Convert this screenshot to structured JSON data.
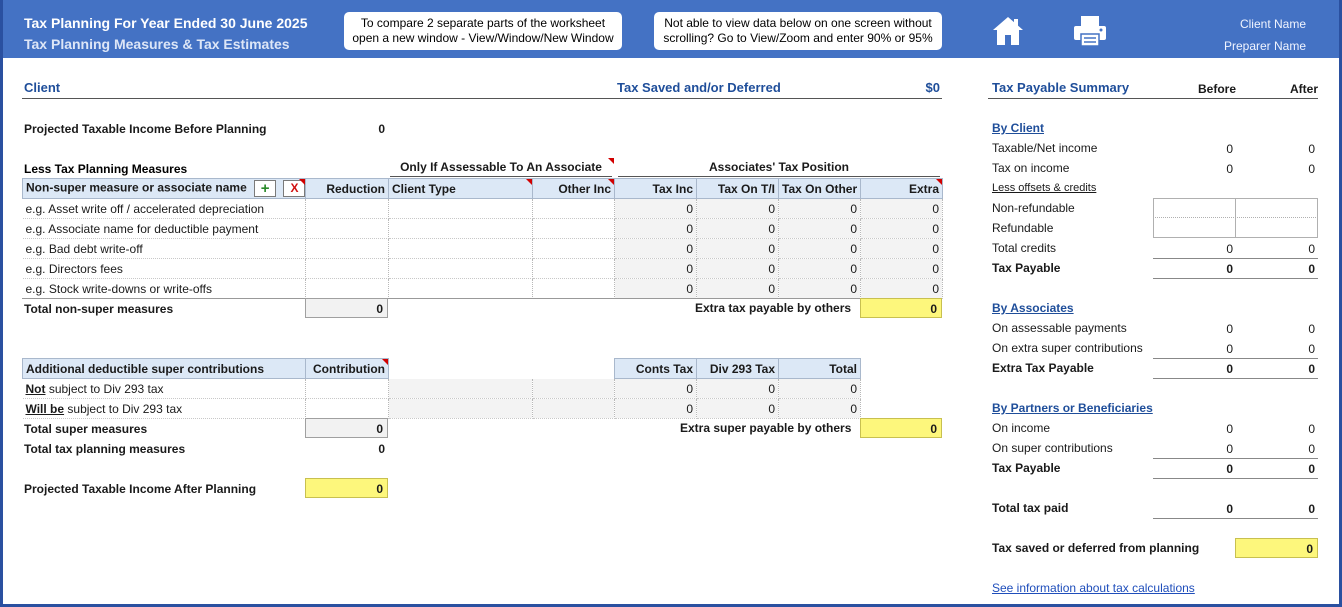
{
  "header": {
    "title": "Tax Planning For Year Ended 30 June 2025",
    "subtitle": "Tax Planning Measures & Tax Estimates",
    "note1_line1": "To compare 2 separate parts of the worksheet",
    "note1_line2": "open a new window - View/Window/New Window",
    "note2_line1": "Not able to view data below on one screen without",
    "note2_line2": "scrolling? Go to View/Zoom and enter 90% or 95%",
    "client_name": "Client Name",
    "preparer_name": "Preparer Name"
  },
  "left": {
    "client_label": "Client",
    "tax_saved_label": "Tax Saved and/or Deferred",
    "tax_saved_value": "$0",
    "projected_before_label": "Projected Taxable Income Before Planning",
    "projected_before_value": "0",
    "less_measures_label": "Less Tax Planning Measures",
    "assoc_only_label": "Only If Assessable To An Associate",
    "assoc_position_label": "Associates' Tax Position",
    "nonsuper_headers": [
      "Non-super measure or associate name",
      "Reduction",
      "Client Type",
      "Other Inc",
      "Tax Inc",
      "Tax On T/I",
      "Tax On Other",
      "Extra"
    ],
    "add_label": "+",
    "delete_label": "X",
    "nonsuper_rows": [
      {
        "name": "e.g. Asset write off / accelerated depreciation",
        "tax_inc": "0",
        "tax_ti": "0",
        "tax_other": "0",
        "extra": "0"
      },
      {
        "name": "e.g. Associate name for deductible payment",
        "tax_inc": "0",
        "tax_ti": "0",
        "tax_other": "0",
        "extra": "0"
      },
      {
        "name": "e.g. Bad debt write-off",
        "tax_inc": "0",
        "tax_ti": "0",
        "tax_other": "0",
        "extra": "0"
      },
      {
        "name": "e.g. Directors fees",
        "tax_inc": "0",
        "tax_ti": "0",
        "tax_other": "0",
        "extra": "0"
      },
      {
        "name": "e.g. Stock write-downs or write-offs",
        "tax_inc": "0",
        "tax_ti": "0",
        "tax_other": "0",
        "extra": "0"
      }
    ],
    "total_nonsuper_label": "Total non-super measures",
    "total_nonsuper_value": "0",
    "extra_tax_others_label": "Extra tax payable by others",
    "extra_tax_others_value": "0",
    "super_headers": [
      "Additional deductible super contributions",
      "Contribution",
      "Conts Tax",
      "Div 293 Tax",
      "Total"
    ],
    "super_rows": [
      {
        "prefix": "Not",
        "rest": " subject to Div 293 tax",
        "cont_tax": "0",
        "div293": "0",
        "total": "0"
      },
      {
        "prefix": "Will be",
        "rest": " subject to Div 293 tax",
        "cont_tax": "0",
        "div293": "0",
        "total": "0"
      }
    ],
    "total_super_label": "Total super measures",
    "total_super_value": "0",
    "extra_super_label": "Extra super payable by others",
    "extra_super_value": "0",
    "total_planning_label": "Total tax planning measures",
    "total_planning_value": "0",
    "projected_after_label": "Projected Taxable Income After Planning",
    "projected_after_value": "0"
  },
  "summary": {
    "title": "Tax Payable Summary",
    "before_label": "Before",
    "after_label": "After",
    "by_client": "By Client",
    "taxable_net_income": "Taxable/Net income",
    "tni_before": "0",
    "tni_after": "0",
    "tax_on_income": "Tax on income",
    "toi_before": "0",
    "toi_after": "0",
    "less_offsets": "Less offsets & credits",
    "non_refundable": "Non-refundable",
    "refundable": "Refundable",
    "total_credits": "Total credits",
    "tc_before": "0",
    "tc_after": "0",
    "tax_payable": "Tax Payable",
    "tp_before": "0",
    "tp_after": "0",
    "by_associates": "By Associates",
    "on_assessable": "On assessable payments",
    "oa_before": "0",
    "oa_after": "0",
    "on_extra_super": "On extra super contributions",
    "oes_before": "0",
    "oes_after": "0",
    "extra_tax_payable": "Extra Tax Payable",
    "etp_before": "0",
    "etp_after": "0",
    "by_partners": "By Partners or Beneficiaries",
    "on_income": "On income",
    "oi_before": "0",
    "oi_after": "0",
    "on_super": "On super contributions",
    "os_before": "0",
    "os_after": "0",
    "tax_payable2": "Tax Payable",
    "tp2_before": "0",
    "tp2_after": "0",
    "total_tax_paid": "Total tax paid",
    "ttp_before": "0",
    "ttp_after": "0",
    "tax_saved_label": "Tax saved or deferred from planning",
    "tax_saved_value": "0",
    "info_link": "See information about tax calculations"
  }
}
